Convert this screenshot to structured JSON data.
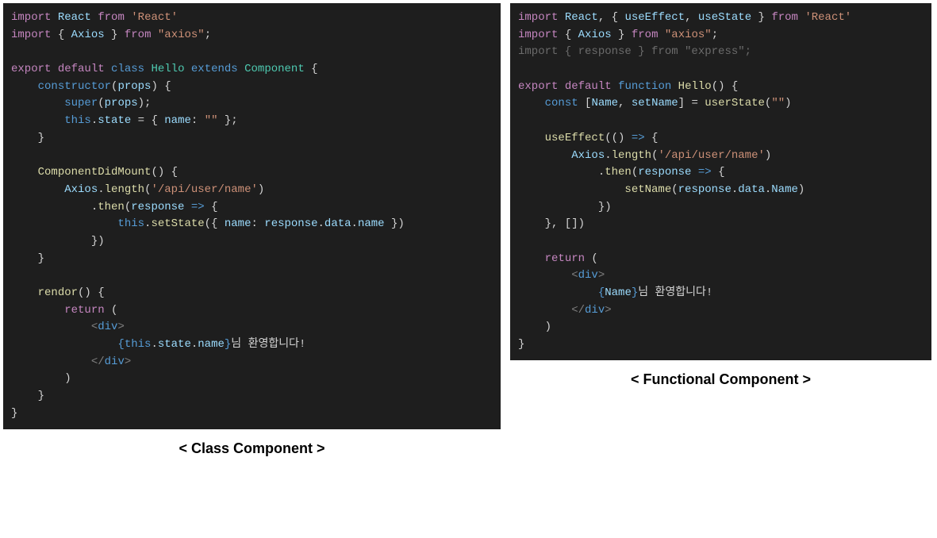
{
  "left": {
    "caption": "< Class Component >",
    "code": [
      [
        [
          "kw-import",
          "import"
        ],
        [
          "kw-plain",
          " "
        ],
        [
          "kw-var",
          "React"
        ],
        [
          "kw-plain",
          " "
        ],
        [
          "kw-import",
          "from"
        ],
        [
          "kw-plain",
          " "
        ],
        [
          "kw-str",
          "'React'"
        ]
      ],
      [
        [
          "kw-import",
          "import"
        ],
        [
          "kw-plain",
          " { "
        ],
        [
          "kw-var",
          "Axios"
        ],
        [
          "kw-plain",
          " } "
        ],
        [
          "kw-import",
          "from"
        ],
        [
          "kw-plain",
          " "
        ],
        [
          "kw-str",
          "\"axios\""
        ],
        [
          "kw-plain",
          ";"
        ]
      ],
      [
        [
          "kw-plain",
          ""
        ]
      ],
      [
        [
          "kw-import",
          "export"
        ],
        [
          "kw-plain",
          " "
        ],
        [
          "kw-import",
          "default"
        ],
        [
          "kw-plain",
          " "
        ],
        [
          "kw-blue",
          "class"
        ],
        [
          "kw-plain",
          " "
        ],
        [
          "kw-type",
          "Hello"
        ],
        [
          "kw-plain",
          " "
        ],
        [
          "kw-blue",
          "extends"
        ],
        [
          "kw-plain",
          " "
        ],
        [
          "kw-type",
          "Component"
        ],
        [
          "kw-plain",
          " {"
        ]
      ],
      [
        [
          "kw-plain",
          "    "
        ],
        [
          "kw-blue",
          "constructor"
        ],
        [
          "kw-plain",
          "("
        ],
        [
          "kw-var",
          "props"
        ],
        [
          "kw-plain",
          ") {"
        ]
      ],
      [
        [
          "kw-plain",
          "        "
        ],
        [
          "kw-blue",
          "super"
        ],
        [
          "kw-plain",
          "("
        ],
        [
          "kw-var",
          "props"
        ],
        [
          "kw-plain",
          ");"
        ]
      ],
      [
        [
          "kw-plain",
          "        "
        ],
        [
          "kw-blue",
          "this"
        ],
        [
          "kw-plain",
          "."
        ],
        [
          "kw-var",
          "state"
        ],
        [
          "kw-plain",
          " = { "
        ],
        [
          "kw-var",
          "name"
        ],
        [
          "kw-plain",
          ": "
        ],
        [
          "kw-str",
          "\"\""
        ],
        [
          "kw-plain",
          " };"
        ]
      ],
      [
        [
          "kw-plain",
          "    }"
        ]
      ],
      [
        [
          "kw-plain",
          ""
        ]
      ],
      [
        [
          "kw-plain",
          "    "
        ],
        [
          "kw-fn",
          "ComponentDidMount"
        ],
        [
          "kw-plain",
          "() {"
        ]
      ],
      [
        [
          "kw-plain",
          "        "
        ],
        [
          "kw-var",
          "Axios"
        ],
        [
          "kw-plain",
          "."
        ],
        [
          "kw-fn",
          "length"
        ],
        [
          "kw-plain",
          "("
        ],
        [
          "kw-str",
          "'/api/user/name'"
        ],
        [
          "kw-plain",
          ")"
        ]
      ],
      [
        [
          "kw-plain",
          "            ."
        ],
        [
          "kw-fn",
          "then"
        ],
        [
          "kw-plain",
          "("
        ],
        [
          "kw-var",
          "response"
        ],
        [
          "kw-plain",
          " "
        ],
        [
          "kw-blue",
          "=>"
        ],
        [
          "kw-plain",
          " {"
        ]
      ],
      [
        [
          "kw-plain",
          "                "
        ],
        [
          "kw-blue",
          "this"
        ],
        [
          "kw-plain",
          "."
        ],
        [
          "kw-fn",
          "setState"
        ],
        [
          "kw-plain",
          "({ "
        ],
        [
          "kw-var",
          "name"
        ],
        [
          "kw-plain",
          ": "
        ],
        [
          "kw-var",
          "response"
        ],
        [
          "kw-plain",
          "."
        ],
        [
          "kw-var",
          "data"
        ],
        [
          "kw-plain",
          "."
        ],
        [
          "kw-var",
          "name"
        ],
        [
          "kw-plain",
          " })"
        ]
      ],
      [
        [
          "kw-plain",
          "            })"
        ]
      ],
      [
        [
          "kw-plain",
          "    }"
        ]
      ],
      [
        [
          "kw-plain",
          ""
        ]
      ],
      [
        [
          "kw-plain",
          "    "
        ],
        [
          "kw-fn",
          "rendor"
        ],
        [
          "kw-plain",
          "() {"
        ]
      ],
      [
        [
          "kw-plain",
          "        "
        ],
        [
          "kw-import",
          "return"
        ],
        [
          "kw-plain",
          " ("
        ]
      ],
      [
        [
          "kw-plain",
          "            "
        ],
        [
          "kw-tag",
          "<"
        ],
        [
          "kw-tagname",
          "div"
        ],
        [
          "kw-tag",
          ">"
        ]
      ],
      [
        [
          "kw-plain",
          "                "
        ],
        [
          "kw-curly",
          "{"
        ],
        [
          "kw-blue",
          "this"
        ],
        [
          "kw-plain",
          "."
        ],
        [
          "kw-var",
          "state"
        ],
        [
          "kw-plain",
          "."
        ],
        [
          "kw-var",
          "name"
        ],
        [
          "kw-curly",
          "}"
        ],
        [
          "kw-plain",
          "님 환영합니다!"
        ]
      ],
      [
        [
          "kw-plain",
          "            "
        ],
        [
          "kw-tag",
          "</"
        ],
        [
          "kw-tagname",
          "div"
        ],
        [
          "kw-tag",
          ">"
        ]
      ],
      [
        [
          "kw-plain",
          "        )"
        ]
      ],
      [
        [
          "kw-plain",
          "    }"
        ]
      ],
      [
        [
          "kw-plain",
          "}"
        ]
      ]
    ]
  },
  "right": {
    "caption": "< Functional Component >",
    "code": [
      [
        [
          "kw-import",
          "import"
        ],
        [
          "kw-plain",
          " "
        ],
        [
          "kw-var",
          "React"
        ],
        [
          "kw-plain",
          ", { "
        ],
        [
          "kw-var",
          "useEffect"
        ],
        [
          "kw-plain",
          ", "
        ],
        [
          "kw-var",
          "useState"
        ],
        [
          "kw-plain",
          " } "
        ],
        [
          "kw-import",
          "from"
        ],
        [
          "kw-plain",
          " "
        ],
        [
          "kw-str",
          "'React'"
        ]
      ],
      [
        [
          "kw-import",
          "import"
        ],
        [
          "kw-plain",
          " { "
        ],
        [
          "kw-var",
          "Axios"
        ],
        [
          "kw-plain",
          " } "
        ],
        [
          "kw-import",
          "from"
        ],
        [
          "kw-plain",
          " "
        ],
        [
          "kw-str",
          "\"axios\""
        ],
        [
          "kw-plain",
          ";"
        ]
      ],
      [
        [
          "dim",
          "import { response } from \"express\";"
        ]
      ],
      [
        [
          "kw-plain",
          ""
        ]
      ],
      [
        [
          "kw-import",
          "export"
        ],
        [
          "kw-plain",
          " "
        ],
        [
          "kw-import",
          "default"
        ],
        [
          "kw-plain",
          " "
        ],
        [
          "kw-blue",
          "function"
        ],
        [
          "kw-plain",
          " "
        ],
        [
          "kw-fn",
          "Hello"
        ],
        [
          "kw-plain",
          "() {"
        ]
      ],
      [
        [
          "kw-plain",
          "    "
        ],
        [
          "kw-blue",
          "const"
        ],
        [
          "kw-plain",
          " ["
        ],
        [
          "kw-var",
          "Name"
        ],
        [
          "kw-plain",
          ", "
        ],
        [
          "kw-var",
          "setName"
        ],
        [
          "kw-plain",
          "] = "
        ],
        [
          "kw-fn",
          "userState"
        ],
        [
          "kw-plain",
          "("
        ],
        [
          "kw-str",
          "\"\""
        ],
        [
          "kw-plain",
          ")"
        ]
      ],
      [
        [
          "kw-plain",
          ""
        ]
      ],
      [
        [
          "kw-plain",
          "    "
        ],
        [
          "kw-fn",
          "useEffect"
        ],
        [
          "kw-plain",
          "(() "
        ],
        [
          "kw-blue",
          "=>"
        ],
        [
          "kw-plain",
          " {"
        ]
      ],
      [
        [
          "kw-plain",
          "        "
        ],
        [
          "kw-var",
          "Axios"
        ],
        [
          "kw-plain",
          "."
        ],
        [
          "kw-fn",
          "length"
        ],
        [
          "kw-plain",
          "("
        ],
        [
          "kw-str",
          "'/api/user/name'"
        ],
        [
          "kw-plain",
          ")"
        ]
      ],
      [
        [
          "kw-plain",
          "            ."
        ],
        [
          "kw-fn",
          "then"
        ],
        [
          "kw-plain",
          "("
        ],
        [
          "kw-var",
          "response"
        ],
        [
          "kw-plain",
          " "
        ],
        [
          "kw-blue",
          "=>"
        ],
        [
          "kw-plain",
          " {"
        ]
      ],
      [
        [
          "kw-plain",
          "                "
        ],
        [
          "kw-fn",
          "setName"
        ],
        [
          "kw-plain",
          "("
        ],
        [
          "kw-var",
          "response"
        ],
        [
          "kw-plain",
          "."
        ],
        [
          "kw-var",
          "data"
        ],
        [
          "kw-plain",
          "."
        ],
        [
          "kw-var",
          "Name"
        ],
        [
          "kw-plain",
          ")"
        ]
      ],
      [
        [
          "kw-plain",
          "            })"
        ]
      ],
      [
        [
          "kw-plain",
          "    }, [])"
        ]
      ],
      [
        [
          "kw-plain",
          ""
        ]
      ],
      [
        [
          "kw-plain",
          "    "
        ],
        [
          "kw-import",
          "return"
        ],
        [
          "kw-plain",
          " ("
        ]
      ],
      [
        [
          "kw-plain",
          "        "
        ],
        [
          "kw-tag",
          "<"
        ],
        [
          "kw-tagname",
          "div"
        ],
        [
          "kw-tag",
          ">"
        ]
      ],
      [
        [
          "kw-plain",
          "            "
        ],
        [
          "kw-curly",
          "{"
        ],
        [
          "kw-var",
          "Name"
        ],
        [
          "kw-curly",
          "}"
        ],
        [
          "kw-plain",
          "님 환영합니다!"
        ]
      ],
      [
        [
          "kw-plain",
          "        "
        ],
        [
          "kw-tag",
          "</"
        ],
        [
          "kw-tagname",
          "div"
        ],
        [
          "kw-tag",
          ">"
        ]
      ],
      [
        [
          "kw-plain",
          "    )"
        ]
      ],
      [
        [
          "kw-plain",
          "}"
        ]
      ]
    ]
  }
}
